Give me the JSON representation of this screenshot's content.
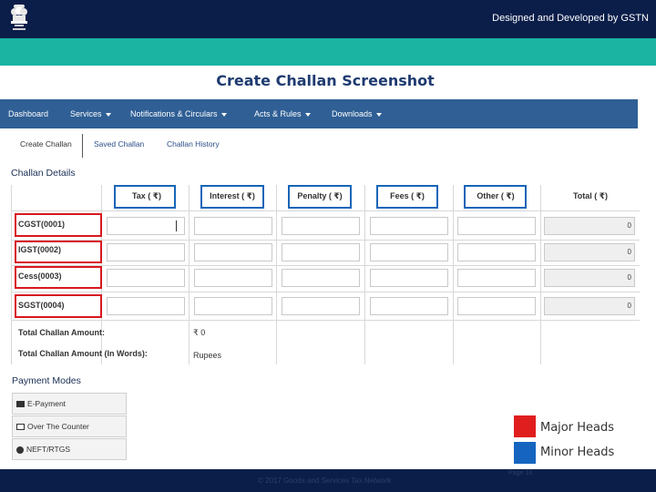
{
  "header": {
    "credit": "Designed and Developed by GSTN"
  },
  "slide": {
    "title": "Create Challan Screenshot"
  },
  "nav": [
    {
      "label": "Dashboard",
      "has_caret": false
    },
    {
      "label": "Services",
      "has_caret": true
    },
    {
      "label": "Notifications & Circulars",
      "has_caret": true
    },
    {
      "label": "Acts & Rules",
      "has_caret": true
    },
    {
      "label": "Downloads",
      "has_caret": true
    }
  ],
  "subtabs": [
    "Create Challan",
    "Saved Challan",
    "Challan History"
  ],
  "challan": {
    "title": "Challan Details",
    "columns": [
      "Tax ( ₹)",
      "Interest ( ₹)",
      "Penalty ( ₹)",
      "Fees ( ₹)",
      "Other ( ₹)",
      "Total ( ₹)"
    ],
    "rows": [
      {
        "head": "CGST(0001)",
        "total": "0"
      },
      {
        "head": "IGST(0002)",
        "total": "0"
      },
      {
        "head": "Cess(0003)",
        "total": "0"
      },
      {
        "head": "SGST(0004)",
        "total": "0"
      }
    ],
    "total_amount_label": "Total Challan Amount:",
    "total_amount_value": "₹ 0",
    "total_words_label": "Total Challan Amount (In Words):",
    "total_words_value": "Rupees"
  },
  "payment": {
    "title": "Payment Modes",
    "options": [
      {
        "label": "E-Payment",
        "icon": "card-icon"
      },
      {
        "label": "Over The Counter",
        "icon": "cash-icon"
      },
      {
        "label": "NEFT/RTGS",
        "icon": "transfer-icon"
      }
    ]
  },
  "legend": [
    {
      "label": "Major Heads",
      "color": "#e01e1e"
    },
    {
      "label": "Minor Heads",
      "color": "#1565c0"
    }
  ],
  "colors": {
    "header_bg": "#0b1e4a",
    "teal_band": "#1bb3a2",
    "nav_bg": "#2f5f95",
    "major_outline": "#d71920",
    "minor_outline": "#1765b8"
  },
  "footer": {
    "text": "© 2017 Goods and Services Tax Network",
    "page": "Page 18"
  }
}
